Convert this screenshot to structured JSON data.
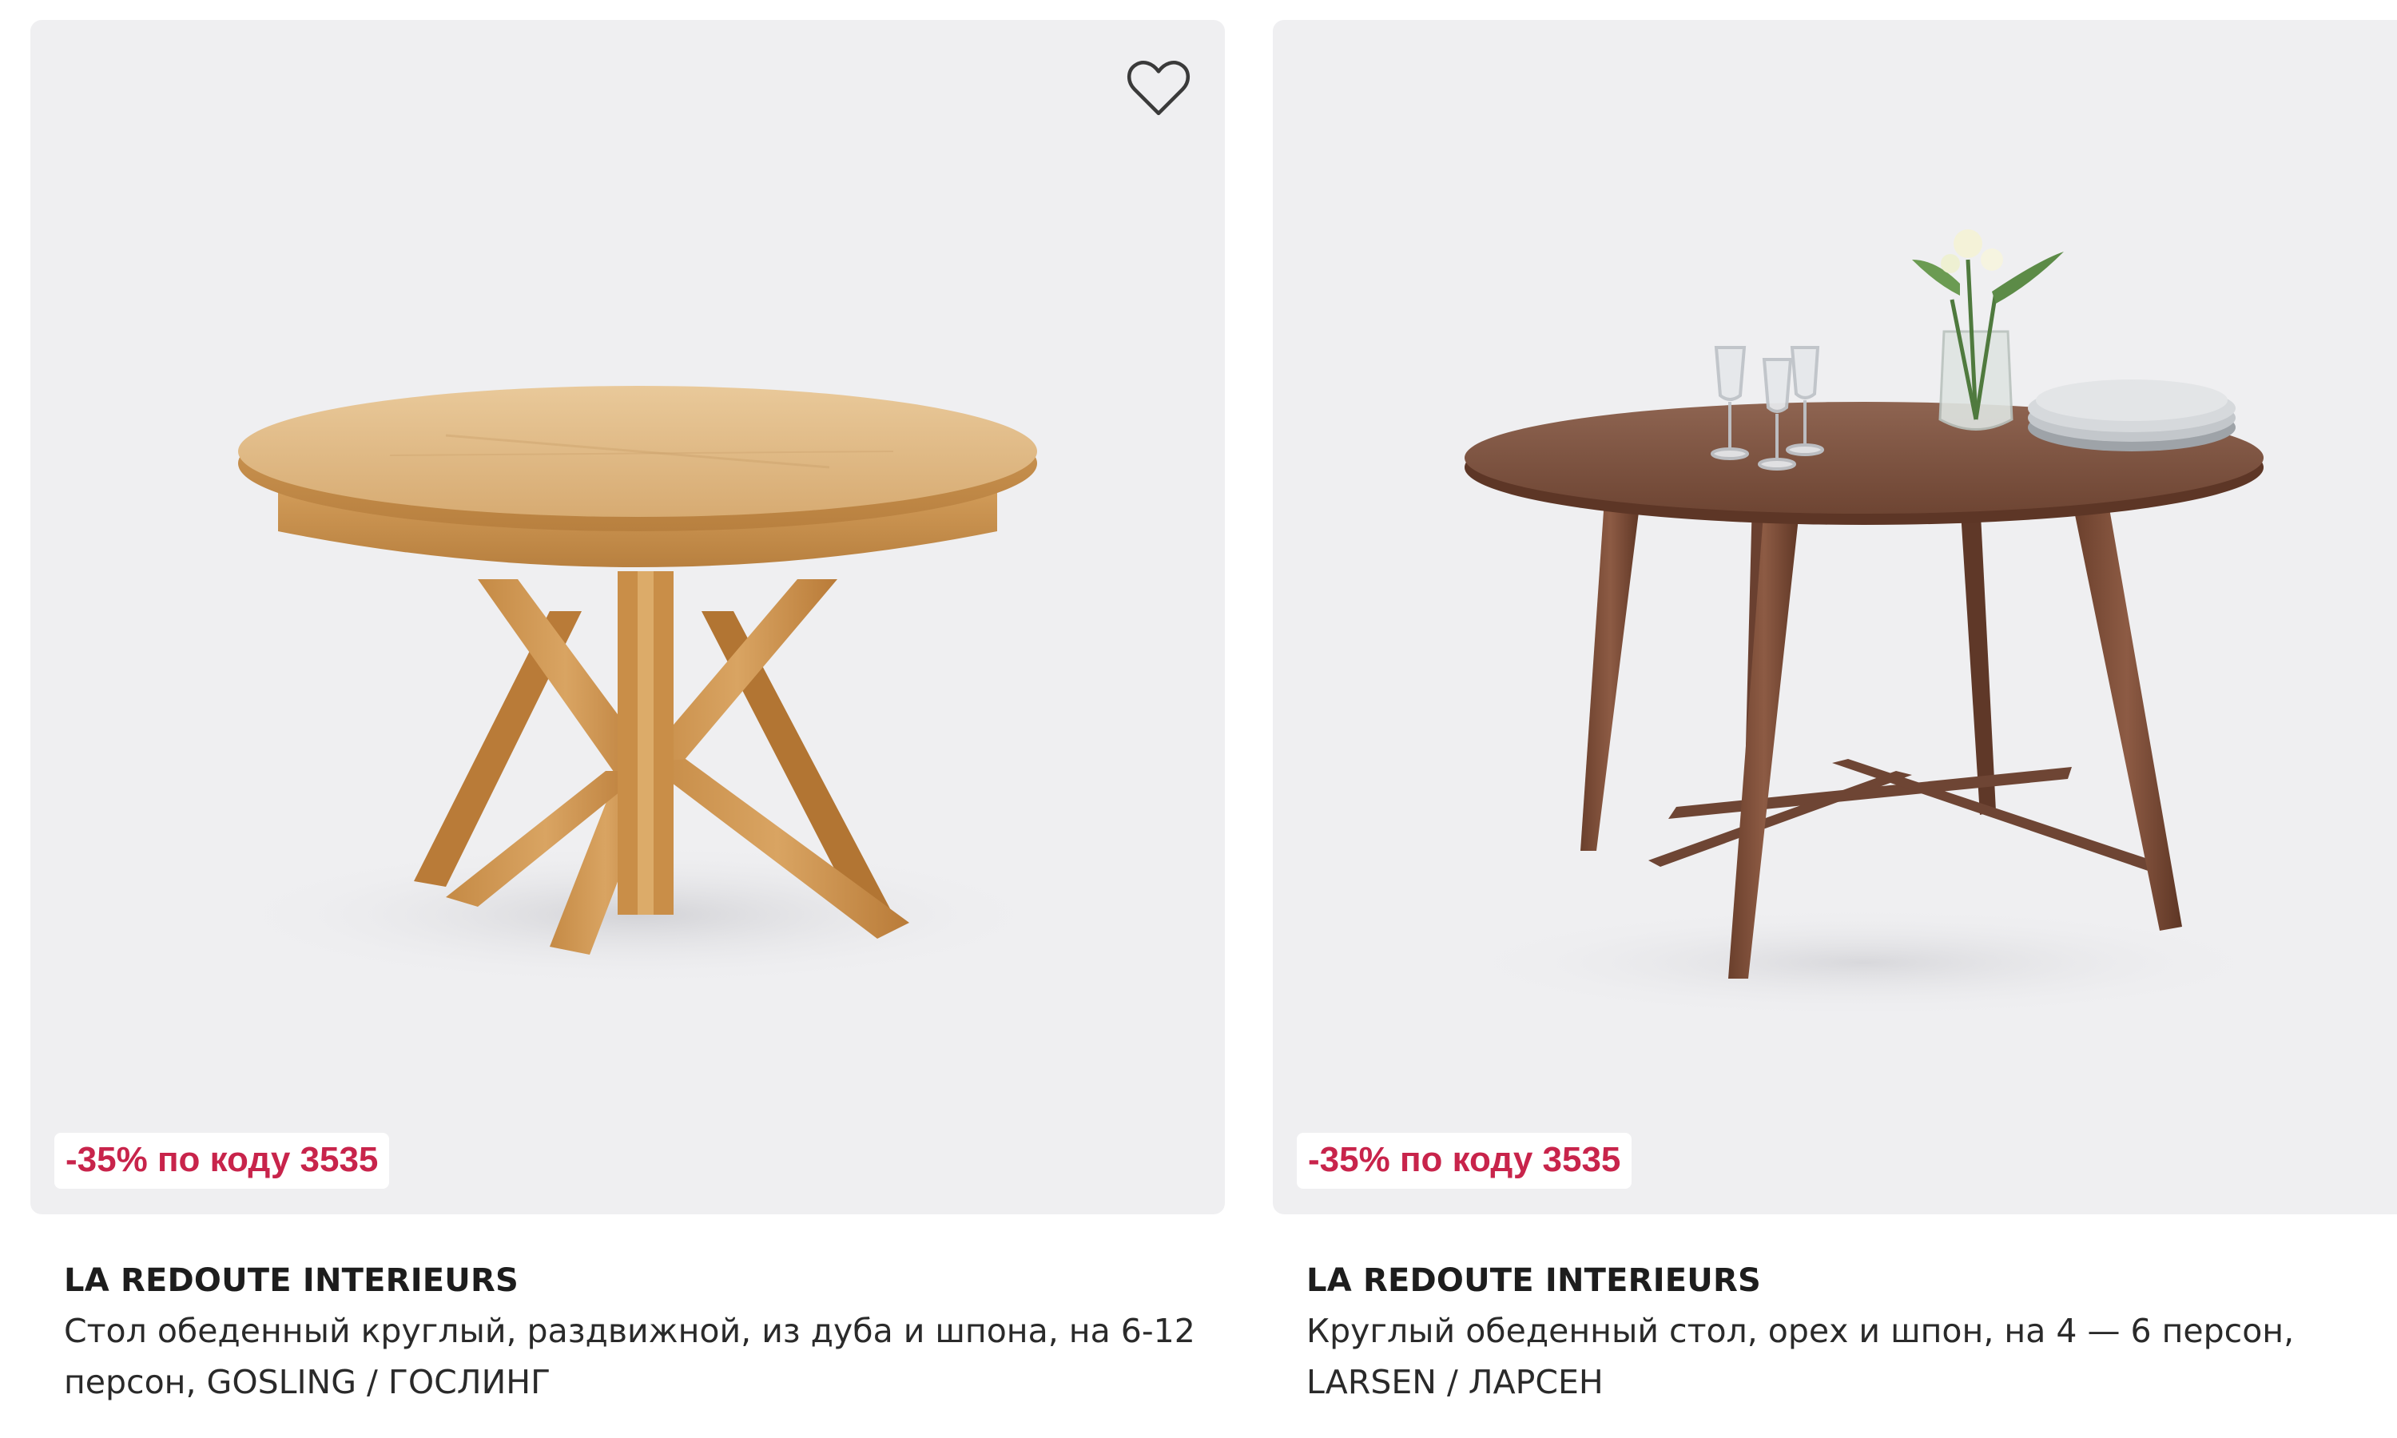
{
  "products": [
    {
      "brand": "LA REDOUTE INTERIEURS",
      "title": "Стол обеденный круглый, раздвижной, из дуба и шпона, на 6-12 персон, GOSLING / ГОСЛИНГ",
      "promo": "-35% по коду 3535",
      "favorite_icon": "heart-outline-icon",
      "image_alt": "round oak extendable dining table"
    },
    {
      "brand": "LA REDOUTE INTERIEURS",
      "title": "Круглый обеденный стол, орех и шпон, на 4 — 6 персон, LARSEN / ЛАРСЕН",
      "promo": "-35% по коду 3535",
      "favorite_icon": "heart-outline-icon",
      "image_alt": "round walnut dining table"
    }
  ],
  "colors": {
    "promo_text": "#c8244b",
    "card_bg": "#efeff1",
    "oak": "#d6a76a",
    "walnut": "#7a4f3a"
  }
}
